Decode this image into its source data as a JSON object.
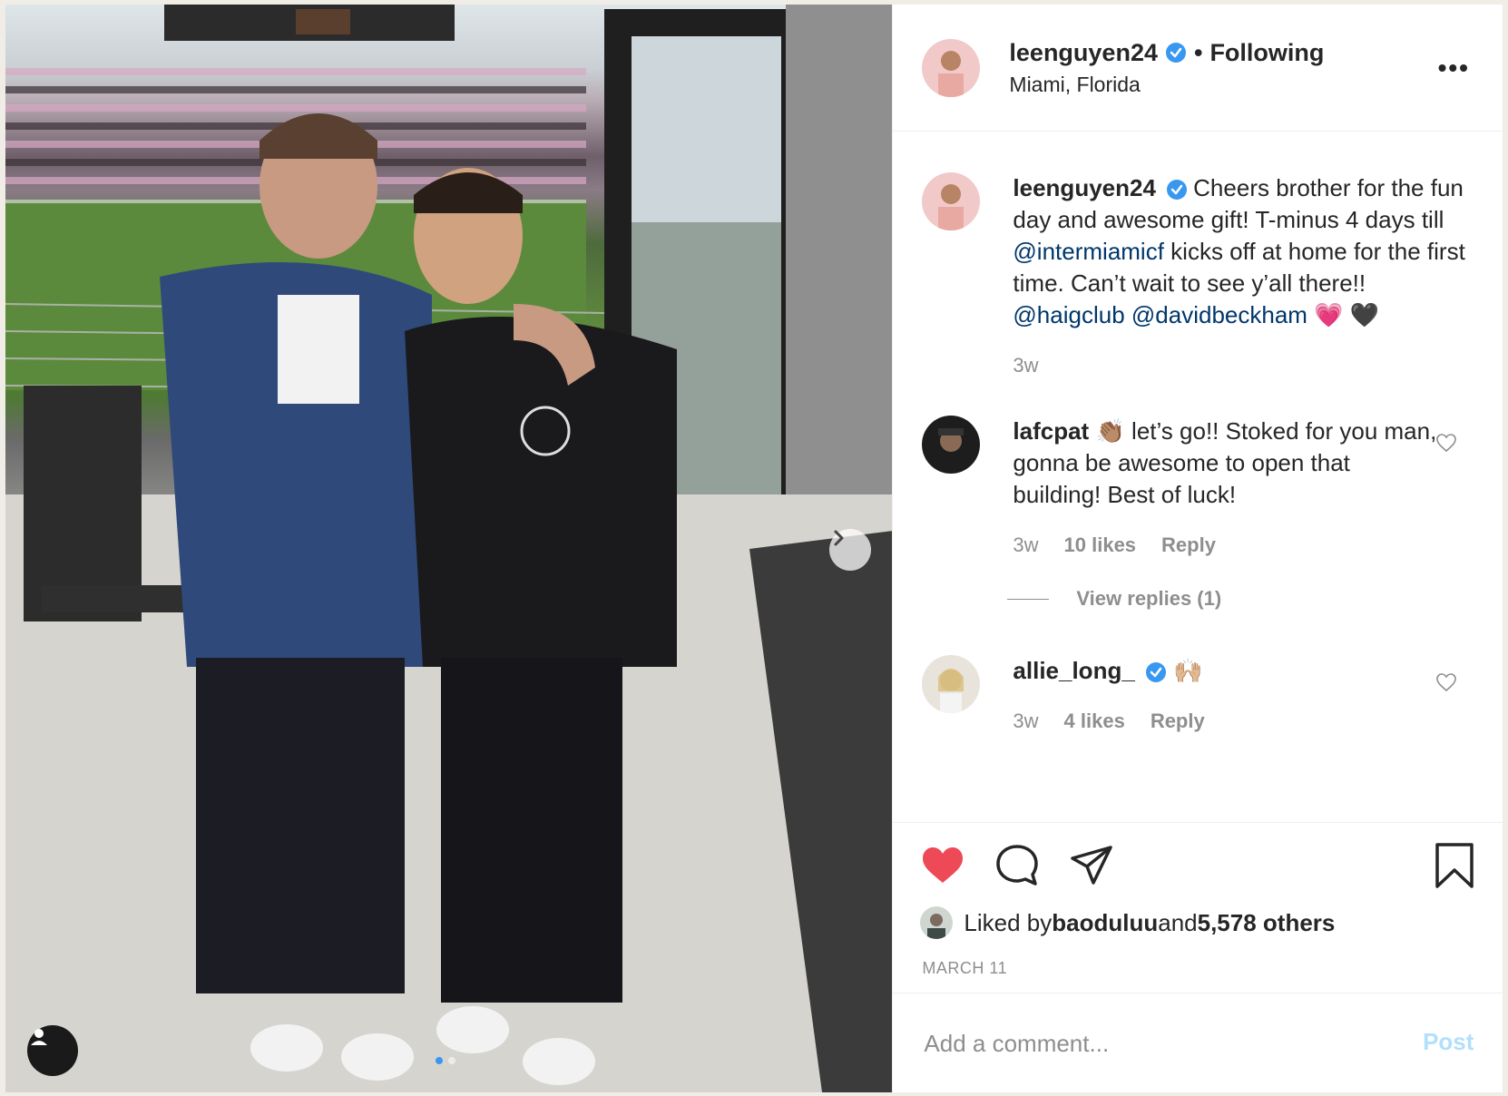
{
  "post": {
    "username": "leenguyen24",
    "follow_status": "Following",
    "separator": "•",
    "location": "Miami, Florida",
    "more_label": "•••"
  },
  "caption": {
    "username": "leenguyen24",
    "text_1": "Cheers brother for the fun day and awesome gift! T-minus 4 days till ",
    "mention_1": "@intermiamicf",
    "text_2": " kicks off at home for the first time. Can’t wait to see y’all there!! ",
    "mention_2": "@haigclub",
    "text_3": " ",
    "mention_3": "@davidbeckham",
    "emojis": " 💗 🖤",
    "time": "3w"
  },
  "comments": [
    {
      "username": "lafcpat",
      "text": " 👏🏽  let’s go!! Stoked for you man, gonna be awesome to open that building! Best of luck!",
      "time": "3w",
      "likes": "10 likes",
      "reply": "Reply",
      "view_replies": "View replies (1)"
    },
    {
      "username": "allie_long_",
      "text": " 🙌🏼",
      "time": "3w",
      "likes": "4 likes",
      "reply": "Reply"
    }
  ],
  "engagement": {
    "liked_prefix": "Liked by ",
    "liked_user": "baoduluu",
    "liked_mid": " and ",
    "liked_count": "5,578 others",
    "date": "MARCH 11"
  },
  "comment_box": {
    "placeholder": "Add a comment...",
    "post_label": "Post"
  },
  "colors": {
    "like_red": "#ed4956",
    "verified_blue": "#3897f0",
    "mention_blue": "#00376b",
    "post_disabled": "#b2dffc"
  },
  "icons": [
    "chevron-right-icon",
    "user-tag-icon",
    "verified-icon",
    "more-icon",
    "heart-icon",
    "comment-icon",
    "share-icon",
    "bookmark-icon"
  ]
}
